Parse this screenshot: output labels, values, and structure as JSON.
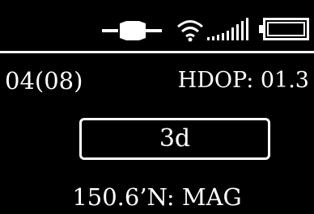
{
  "status_bar": {
    "icons": [
      "gps-satellite-icon",
      "wifi-icon",
      "signal-strength-icon",
      "battery-icon"
    ]
  },
  "info": {
    "satellites": "04(08)",
    "hdop": "HDOP: 01.3"
  },
  "fix": {
    "mode": "3d"
  },
  "heading": {
    "text": "150.6’N: MAG"
  },
  "colors": {
    "background": "#000000",
    "foreground": "#ffffff"
  }
}
